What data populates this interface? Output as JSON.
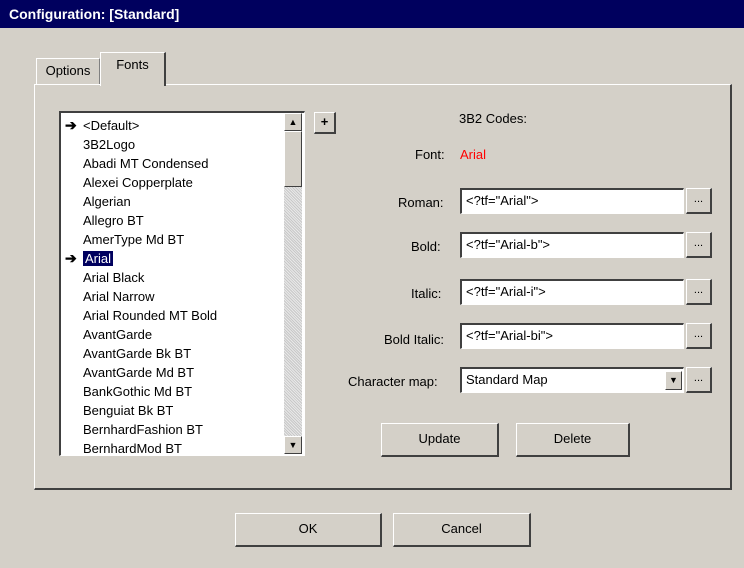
{
  "window": {
    "title": "Configuration: [Standard]"
  },
  "tabs": [
    {
      "label": "Options"
    },
    {
      "label": "Fonts"
    }
  ],
  "font_list": {
    "items": [
      "<Default>",
      "3B2Logo",
      "Abadi MT Condensed",
      "Alexei Copperplate",
      "Algerian",
      "Allegro BT",
      "AmerType Md BT",
      "Arial",
      "Arial Black",
      "Arial Narrow",
      "Arial Rounded MT Bold",
      "AvantGarde",
      "AvantGarde Bk BT",
      "AvantGarde Md BT",
      "BankGothic Md BT",
      "Benguiat Bk BT",
      "BernhardFashion BT",
      "BernhardMod BT"
    ],
    "selected": "Arial",
    "marked": [
      "<Default>",
      "Arial"
    ]
  },
  "add_button": {
    "label": "+"
  },
  "codes": {
    "header": "3B2 Codes:",
    "font_label": "Font:",
    "font_value": "Arial",
    "roman_label": "Roman:",
    "roman_value": "<?tf=\"Arial\">",
    "bold_label": "Bold:",
    "bold_value": "<?tf=\"Arial-b\">",
    "italic_label": "Italic:",
    "italic_value": "<?tf=\"Arial-i\">",
    "bolditalic_label": "Bold Italic:",
    "bolditalic_value": "<?tf=\"Arial-bi\">",
    "browse_label": "...",
    "charmap_label": "Character map:",
    "charmap_value": "Standard Map"
  },
  "buttons": {
    "update": "Update",
    "delete": "Delete",
    "ok": "OK",
    "cancel": "Cancel"
  },
  "colors": {
    "title_bg": "#00005e",
    "font_value": "#ff0000",
    "face": "#d4d0c8"
  }
}
